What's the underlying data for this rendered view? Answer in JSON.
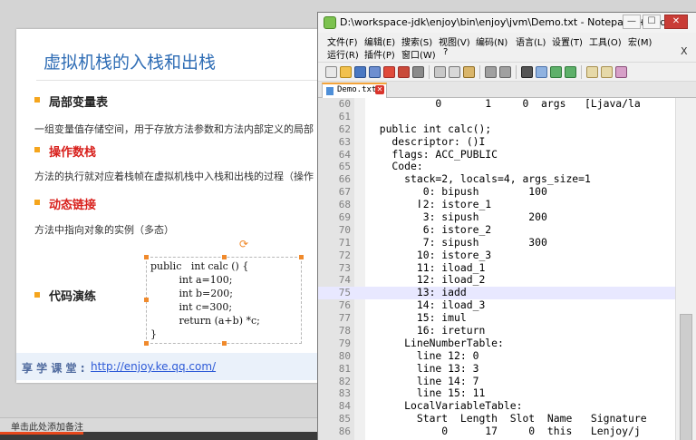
{
  "presentation": {
    "slide_title": "虚拟机栈的入栈和出栈",
    "sections": [
      {
        "heading": "局部变量表",
        "heading_color": "#222222",
        "body": "一组变量值存储空间，用于存放方法参数和方法内部定义的局部"
      },
      {
        "heading": "操作数栈",
        "heading_color": "#d8201c",
        "body": "方法的执行就对应着栈帧在虚拟机栈中入栈和出栈的过程（操作"
      },
      {
        "heading": "动态链接",
        "heading_color": "#d8201c",
        "body": "方法中指向对象的实例（多态）"
      },
      {
        "heading": "代码演练",
        "heading_color": "#222222",
        "body": ""
      }
    ],
    "code_lines": [
      "public   int calc () {",
      "         int a=100;",
      "         int b=200;",
      "         int c=300;",
      "         return (a+b) *c;",
      "}"
    ],
    "footer_label": "享 学 课 堂 :",
    "footer_link": "http://enjoy.ke.qq.com/",
    "notes_placeholder": "单击此处添加备注",
    "progress_fraction": 0.12,
    "accent_color": "#f5a51d",
    "title_color": "#2f6db5"
  },
  "notepad": {
    "window_title": "D:\\workspace-jdk\\enjoy\\bin\\enjoy\\jvm\\Demo.txt - Notepad++ [Ad...",
    "window_buttons": {
      "minimize": "—",
      "maximize": "☐",
      "close": "✕"
    },
    "menu_row1": [
      "文件(F)",
      "编辑(E)",
      "搜索(S)",
      "视图(V)",
      "编码(N)",
      "语言(L)",
      "设置(T)",
      "工具(O)",
      "宏(M)"
    ],
    "menu_row2": [
      "运行(R)",
      "插件(P)",
      "窗口(W)",
      "?"
    ],
    "doc_close": "X",
    "tab_label": "Demo.txt",
    "current_line": 75,
    "lines": [
      {
        "n": "60",
        "text": "           0       1     0  args   [Ljava/la"
      },
      {
        "n": "61",
        "text": ""
      },
      {
        "n": "62",
        "text": "  public int calc();"
      },
      {
        "n": "63",
        "text": "    descriptor: ()I"
      },
      {
        "n": "64",
        "text": "    flags: ACC_PUBLIC"
      },
      {
        "n": "65",
        "text": "    Code:"
      },
      {
        "n": "66",
        "text": "      stack=2, locals=4, args_size=1"
      },
      {
        "n": "67",
        "text": "         0: bipush        100"
      },
      {
        "n": "68",
        "text": "         2: istore_1"
      },
      {
        "n": "69",
        "text": "         3: sipush        200"
      },
      {
        "n": "70",
        "text": "         6: istore_2"
      },
      {
        "n": "71",
        "text": "         7: sipush        300"
      },
      {
        "n": "72",
        "text": "        10: istore_3"
      },
      {
        "n": "73",
        "text": "        11: iload_1"
      },
      {
        "n": "74",
        "text": "        12: iload_2"
      },
      {
        "n": "75",
        "text": "        13: iadd"
      },
      {
        "n": "76",
        "text": "        14: iload_3"
      },
      {
        "n": "77",
        "text": "        15: imul"
      },
      {
        "n": "78",
        "text": "        16: ireturn"
      },
      {
        "n": "79",
        "text": "      LineNumberTable:"
      },
      {
        "n": "80",
        "text": "        line 12: 0"
      },
      {
        "n": "81",
        "text": "        line 13: 3"
      },
      {
        "n": "82",
        "text": "        line 14: 7"
      },
      {
        "n": "83",
        "text": "        line 15: 11"
      },
      {
        "n": "84",
        "text": "      LocalVariableTable:"
      },
      {
        "n": "85",
        "text": "        Start  Length  Slot  Name   Signature"
      },
      {
        "n": "86",
        "text": "            0      17     0  this   Lenjoy/j"
      }
    ]
  }
}
